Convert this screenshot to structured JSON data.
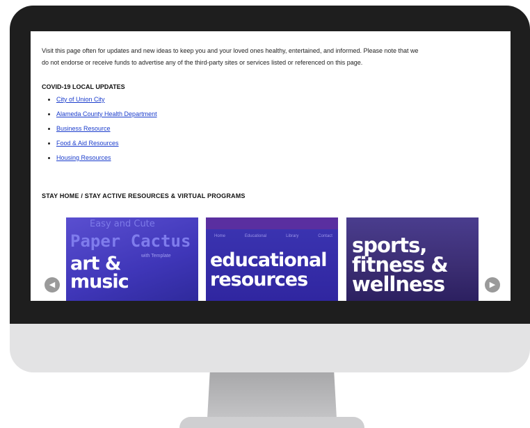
{
  "intro": {
    "line1": "Visit this page often for updates and new ideas to keep you and your loved ones healthy, entertained, and informed.  Please note that we",
    "line2": "do not endorse or receive funds to advertise any of the third-party sites or services listed or referenced on this page."
  },
  "covid": {
    "heading": "COVID-19 LOCAL UPDATES",
    "links": [
      "City of Union City",
      "Alameda County Health Department",
      "Business Resource",
      "Food & Aid Resources",
      "Housing Resources"
    ]
  },
  "stay": {
    "heading": "STAY HOME / STAY ACTIVE RESOURCES & VIRTUAL PROGRAMS"
  },
  "carousel": {
    "prev_icon": "chevron-left-icon",
    "next_icon": "chevron-right-icon",
    "prev_glyph": "◀",
    "next_glyph": "▶",
    "tiles": [
      {
        "bg_title": "Easy and Cute",
        "bg_sub": "Paper Cactus",
        "bg_small": "with Template",
        "caption_line1": "art &",
        "caption_line2": "music"
      },
      {
        "nav": [
          "Home",
          "Educational",
          "Library",
          "Contact"
        ],
        "caption_line1": "educational",
        "caption_line2": "resources"
      },
      {
        "caption_line1": "sports,",
        "caption_line2": "fitness &",
        "caption_line3": "wellness"
      }
    ]
  }
}
